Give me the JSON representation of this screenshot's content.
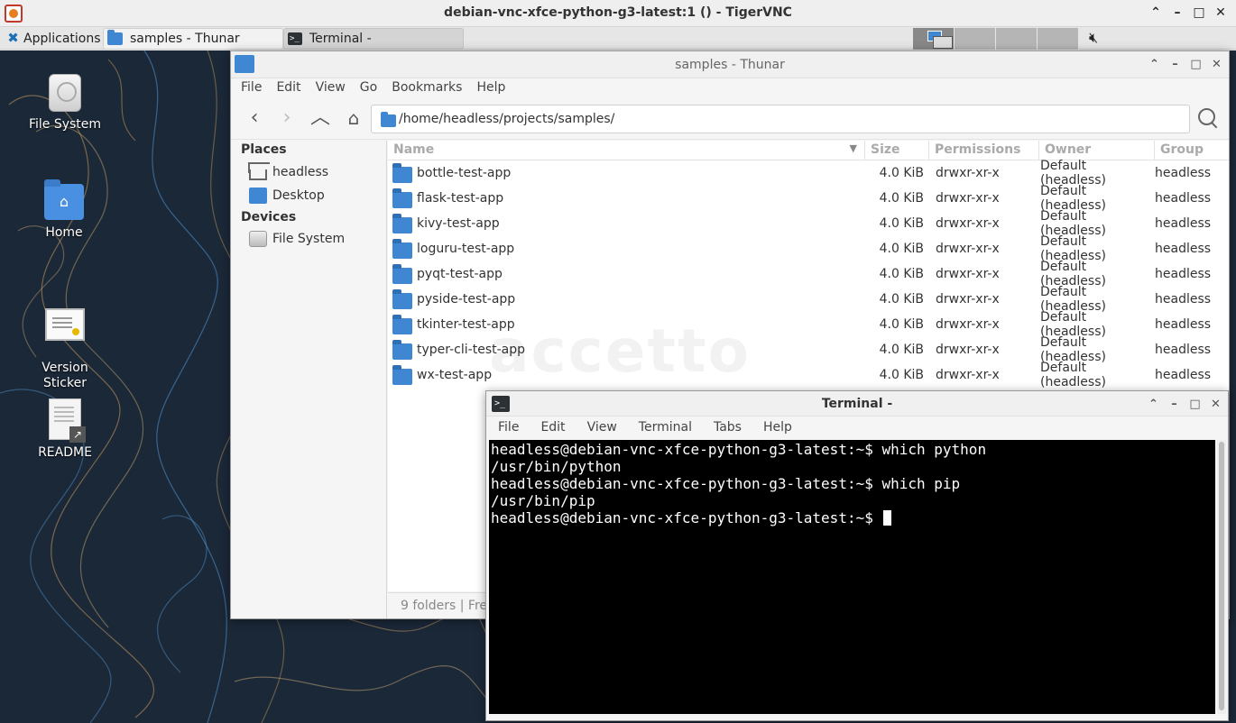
{
  "vnc": {
    "title": "debian-vnc-xfce-python-g3-latest:1 () - TigerVNC"
  },
  "panel": {
    "applications_label": "Applications",
    "tasks": [
      {
        "label": "samples - Thunar"
      },
      {
        "label": "Terminal -"
      }
    ]
  },
  "desktop": {
    "icons": [
      {
        "label": "File System"
      },
      {
        "label": "Home"
      },
      {
        "label": "Version\nSticker"
      },
      {
        "label": "README"
      }
    ]
  },
  "thunar": {
    "title": "samples - Thunar",
    "menu": [
      "File",
      "Edit",
      "View",
      "Go",
      "Bookmarks",
      "Help"
    ],
    "path": "/home/headless/projects/samples/",
    "sidebar": {
      "places_header": "Places",
      "places": [
        "headless",
        "Desktop"
      ],
      "devices_header": "Devices",
      "devices": [
        "File System"
      ]
    },
    "columns": {
      "name": "Name",
      "size": "Size",
      "permissions": "Permissions",
      "owner": "Owner",
      "group": "Group"
    },
    "files": [
      {
        "name": "bottle-test-app",
        "size": "4.0 KiB",
        "perm": "drwxr-xr-x",
        "owner": "Default (headless)",
        "group": "headless"
      },
      {
        "name": "flask-test-app",
        "size": "4.0 KiB",
        "perm": "drwxr-xr-x",
        "owner": "Default (headless)",
        "group": "headless"
      },
      {
        "name": "kivy-test-app",
        "size": "4.0 KiB",
        "perm": "drwxr-xr-x",
        "owner": "Default (headless)",
        "group": "headless"
      },
      {
        "name": "loguru-test-app",
        "size": "4.0 KiB",
        "perm": "drwxr-xr-x",
        "owner": "Default (headless)",
        "group": "headless"
      },
      {
        "name": "pyqt-test-app",
        "size": "4.0 KiB",
        "perm": "drwxr-xr-x",
        "owner": "Default (headless)",
        "group": "headless"
      },
      {
        "name": "pyside-test-app",
        "size": "4.0 KiB",
        "perm": "drwxr-xr-x",
        "owner": "Default (headless)",
        "group": "headless"
      },
      {
        "name": "tkinter-test-app",
        "size": "4.0 KiB",
        "perm": "drwxr-xr-x",
        "owner": "Default (headless)",
        "group": "headless"
      },
      {
        "name": "typer-cli-test-app",
        "size": "4.0 KiB",
        "perm": "drwxr-xr-x",
        "owner": "Default (headless)",
        "group": "headless"
      },
      {
        "name": "wx-test-app",
        "size": "4.0 KiB",
        "perm": "drwxr-xr-x",
        "owner": "Default (headless)",
        "group": "headless"
      }
    ],
    "watermark": "accetto",
    "status": "9 folders  |  Fre"
  },
  "terminal": {
    "title": "Terminal -",
    "menu": [
      "File",
      "Edit",
      "View",
      "Terminal",
      "Tabs",
      "Help"
    ],
    "lines": [
      "headless@debian-vnc-xfce-python-g3-latest:~$ which python",
      "/usr/bin/python",
      "headless@debian-vnc-xfce-python-g3-latest:~$ which pip",
      "/usr/bin/pip"
    ],
    "prompt": "headless@debian-vnc-xfce-python-g3-latest:~$ "
  },
  "colors": {
    "folder": "#3f86d3",
    "desktop_bg": "#1b2838",
    "terminal_bg": "#000000"
  }
}
